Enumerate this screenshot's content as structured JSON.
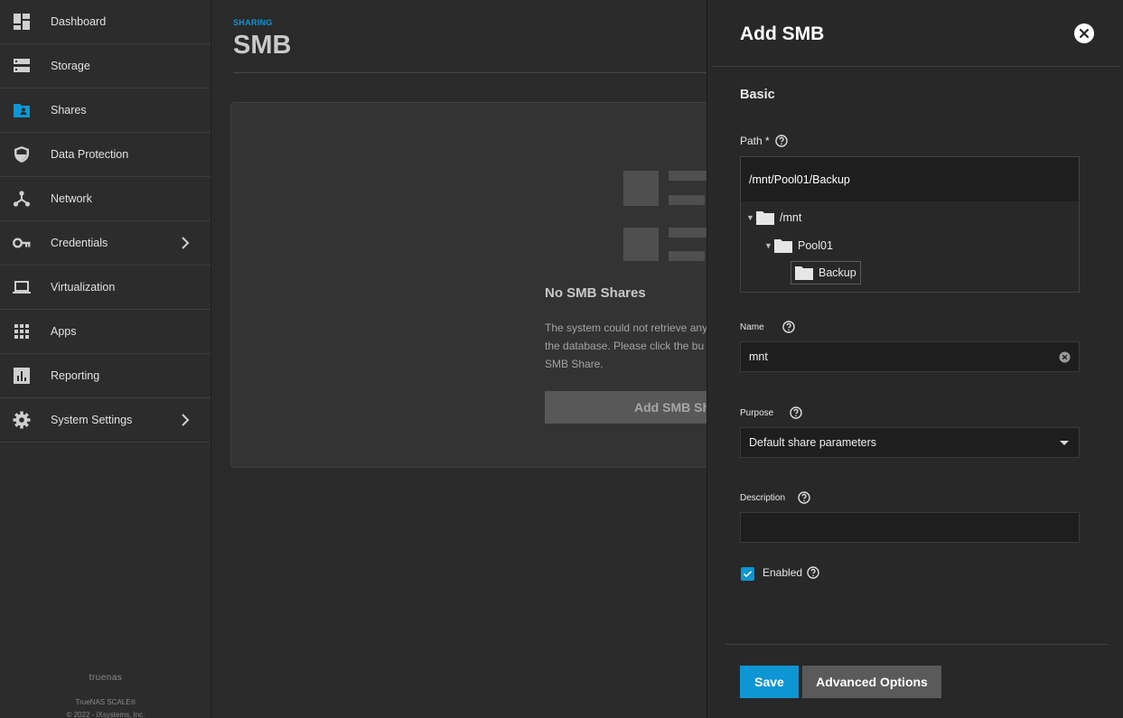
{
  "sidebar": {
    "items": [
      {
        "label": "Dashboard",
        "icon": "dashboard-icon"
      },
      {
        "label": "Storage",
        "icon": "storage-icon"
      },
      {
        "label": "Shares",
        "icon": "shares-folder-icon",
        "active": true
      },
      {
        "label": "Data Protection",
        "icon": "shield-icon"
      },
      {
        "label": "Network",
        "icon": "network-icon"
      },
      {
        "label": "Credentials",
        "icon": "key-icon",
        "has_children": true
      },
      {
        "label": "Virtualization",
        "icon": "laptop-icon"
      },
      {
        "label": "Apps",
        "icon": "apps-grid-icon"
      },
      {
        "label": "Reporting",
        "icon": "chart-icon"
      },
      {
        "label": "System Settings",
        "icon": "gear-icon",
        "has_children": true
      }
    ],
    "footer": {
      "brand": "truenas",
      "version": "TrueNAS SCALE®",
      "copyright": "© 2022 - iXsystems, Inc."
    }
  },
  "main": {
    "breadcrumb": "SHARING",
    "title": "SMB",
    "empty_state": {
      "title": "No SMB Shares",
      "text_lines": [
        "The system could not retrieve any",
        "the database. Please click the bu",
        "SMB Share."
      ],
      "button_label": "Add SMB Sh"
    }
  },
  "panel": {
    "title": "Add SMB",
    "section": "Basic",
    "path": {
      "label": "Path *",
      "value": "/mnt/Pool01/Backup",
      "tree": [
        {
          "label": "/mnt",
          "expanded": true
        },
        {
          "label": "Pool01",
          "expanded": true
        },
        {
          "label": "Backup",
          "selected": true
        }
      ]
    },
    "name": {
      "label": "Name",
      "value": "mnt"
    },
    "purpose": {
      "label": "Purpose",
      "value": "Default share parameters"
    },
    "description": {
      "label": "Description",
      "value": ""
    },
    "enabled": {
      "label": "Enabled",
      "checked": true
    },
    "buttons": {
      "save": "Save",
      "advanced": "Advanced Options"
    }
  },
  "colors": {
    "accent": "#0e95d3",
    "sidebar_bg": "#2c2c2c",
    "panel_bg": "#282828",
    "input_bg": "#1e1e1e"
  }
}
